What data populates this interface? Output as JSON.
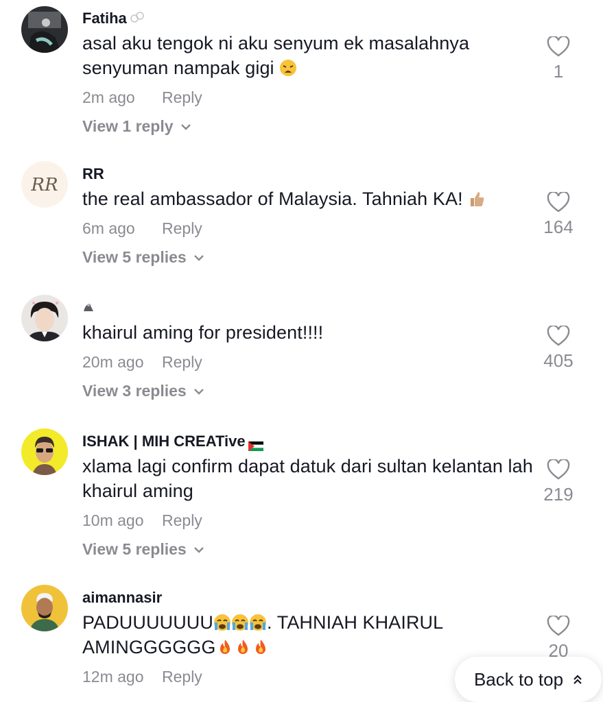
{
  "comments": [
    {
      "username": "Fatiha",
      "text_main": "asal aku tengok ni aku senyum ek masalahnya senyuman nampak gigi",
      "time": "2m ago",
      "reply_label": "Reply",
      "view_replies": "View 1 reply",
      "likes": "1",
      "icon": "weary-face-emoji"
    },
    {
      "username": "RR",
      "text_main": "the real ambassador of Malaysia. Tahniah KA!",
      "time": "6m ago",
      "reply_label": "Reply",
      "view_replies": "View 5 replies",
      "likes": "164",
      "icon": "thumbs-up-emoji"
    },
    {
      "username": "",
      "text_main": "khairul aming for president!!!!",
      "time": "20m ago",
      "reply_label": "Reply",
      "view_replies": "View 3 replies",
      "likes": "405"
    },
    {
      "username": "ISHAK | MIH CREATive",
      "text_main": "xlama lagi confirm dapat datuk dari sultan kelantan lah khairul aming",
      "time": "10m ago",
      "reply_label": "Reply",
      "view_replies": "View 5 replies",
      "likes": "219",
      "icon": "palestine-flag"
    },
    {
      "username": "aimannasir",
      "text_part1": "PADUUUUUUU",
      "text_part2": ". TAHNIAH KHAIRUL AMINGGGGGG",
      "time": "12m ago",
      "reply_label": "Reply",
      "likes": "20",
      "icon": "crying-face-emoji"
    }
  ],
  "back_to_top": "Back to top",
  "colors": {
    "text": "#161823",
    "muted": "#8a8b91"
  }
}
